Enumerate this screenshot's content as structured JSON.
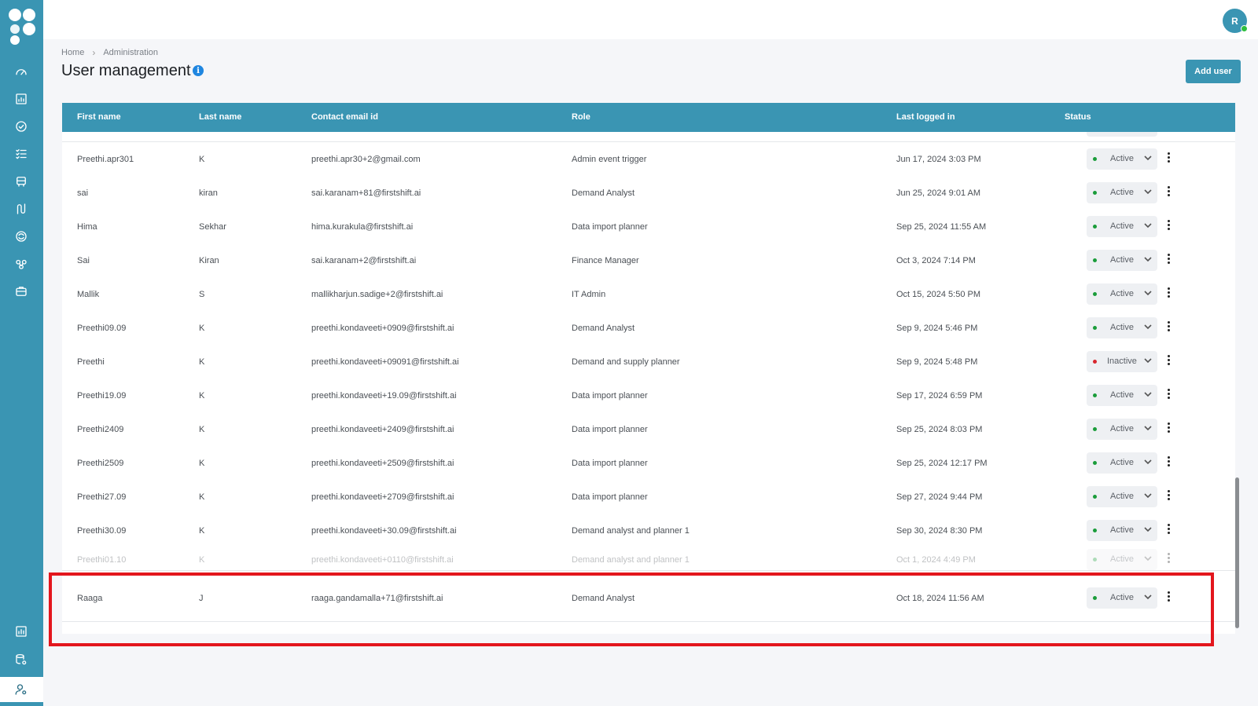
{
  "user": {
    "avatar_initial": "R"
  },
  "breadcrumb": {
    "home": "Home",
    "current": "Administration"
  },
  "page": {
    "title": "User management",
    "info_glyph": "i",
    "add_button": "Add user"
  },
  "table": {
    "columns": [
      "First name",
      "Last name",
      "Contact email id",
      "Role",
      "Last logged in",
      "Status"
    ],
    "rows": [
      {
        "first": "Preethi.apr301",
        "last": "K",
        "email": "preethi.apr30+2@gmail.com",
        "role": "Admin event trigger",
        "last_login": "Jun 17, 2024 3:03 PM",
        "status": "Active"
      },
      {
        "first": "sai",
        "last": "kiran",
        "email": "sai.karanam+81@firstshift.ai",
        "role": "Demand Analyst",
        "last_login": "Jun 25, 2024 9:01 AM",
        "status": "Active"
      },
      {
        "first": "Hima",
        "last": "Sekhar",
        "email": "hima.kurakula@firstshift.ai",
        "role": "Data import planner",
        "last_login": "Sep 25, 2024 11:55 AM",
        "status": "Active"
      },
      {
        "first": "Sai",
        "last": "Kiran",
        "email": "sai.karanam+2@firstshift.ai",
        "role": "Finance Manager",
        "last_login": "Oct 3, 2024 7:14 PM",
        "status": "Active"
      },
      {
        "first": "Mallik",
        "last": "S",
        "email": "mallikharjun.sadige+2@firstshift.ai",
        "role": "IT Admin",
        "last_login": "Oct 15, 2024 5:50 PM",
        "status": "Active"
      },
      {
        "first": "Preethi09.09",
        "last": "K",
        "email": "preethi.kondaveeti+0909@firstshift.ai",
        "role": "Demand Analyst",
        "last_login": "Sep 9, 2024 5:46 PM",
        "status": "Active"
      },
      {
        "first": "Preethi",
        "last": "K",
        "email": "preethi.kondaveeti+09091@firstshift.ai",
        "role": "Demand and supply planner",
        "last_login": "Sep 9, 2024 5:48 PM",
        "status": "Inactive"
      },
      {
        "first": "Preethi19.09",
        "last": "K",
        "email": "preethi.kondaveeti+19.09@firstshift.ai",
        "role": "Data import planner",
        "last_login": "Sep 17, 2024 6:59 PM",
        "status": "Active"
      },
      {
        "first": "Preethi2409",
        "last": "K",
        "email": "preethi.kondaveeti+2409@firstshift.ai",
        "role": "Data import planner",
        "last_login": "Sep 25, 2024 8:03 PM",
        "status": "Active"
      },
      {
        "first": "Preethi2509",
        "last": "K",
        "email": "preethi.kondaveeti+2509@firstshift.ai",
        "role": "Data import planner",
        "last_login": "Sep 25, 2024 12:17 PM",
        "status": "Active"
      },
      {
        "first": "Preethi27.09",
        "last": "K",
        "email": "preethi.kondaveeti+2709@firstshift.ai",
        "role": "Data import planner",
        "last_login": "Sep 27, 2024 9:44 PM",
        "status": "Active"
      },
      {
        "first": "Preethi30.09",
        "last": "K",
        "email": "preethi.kondaveeti+30.09@firstshift.ai",
        "role": "Demand analyst and planner 1",
        "last_login": "Sep 30, 2024 8:30 PM",
        "status": "Active"
      },
      {
        "first": "Preethi01.10",
        "last": "K",
        "email": "preethi.kondaveeti+0110@firstshift.ai",
        "role": "Demand analyst and planner 1",
        "last_login": "Oct 1, 2024 4:49 PM",
        "status": "Active"
      },
      {
        "first": "Raaga",
        "last": "J",
        "email": "raaga.gandamalla+71@firstshift.ai",
        "role": "Demand Analyst",
        "last_login": "Oct 18, 2024 11:56 AM",
        "status": "Active"
      }
    ]
  },
  "colors": {
    "primary": "#3a95b3",
    "active": "#1a9c3a",
    "inactive": "#d8262e",
    "highlight": "#e3161d"
  },
  "icons": {
    "sidebar_top": [
      "dashboard-icon",
      "analytics-icon",
      "check-circle-icon",
      "task-list-icon",
      "inventory-icon",
      "flow-icon",
      "ai-icon",
      "network-icon",
      "briefcase-icon"
    ],
    "sidebar_bottom": [
      "report-icon",
      "data-settings-icon",
      "user-settings-icon"
    ]
  }
}
